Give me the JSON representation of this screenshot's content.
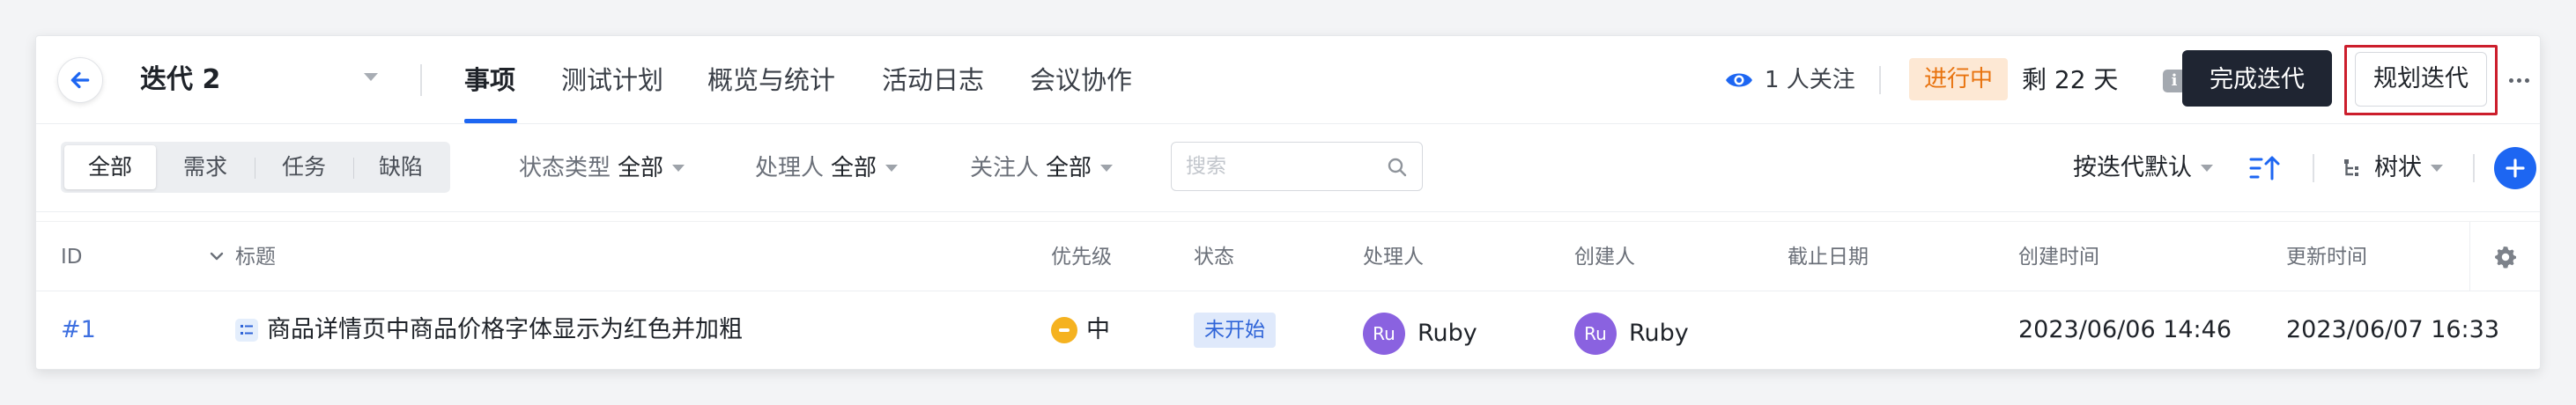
{
  "header": {
    "iteration_title": "迭代 2",
    "tabs": [
      {
        "label": "事项",
        "active": true
      },
      {
        "label": "测试计划",
        "active": false
      },
      {
        "label": "概览与统计",
        "active": false
      },
      {
        "label": "活动日志",
        "active": false
      },
      {
        "label": "会议协作",
        "active": false
      }
    ],
    "watch_text": "1 人关注",
    "status_label": "进行中",
    "remaining": "剩 22 天",
    "info_glyph": "i",
    "complete_button": "完成迭代",
    "plan_button": "规划迭代"
  },
  "toolbar": {
    "segments": [
      "全部",
      "需求",
      "任务",
      "缺陷"
    ],
    "active_segment": "全部",
    "filters": [
      {
        "label": "状态类型",
        "value": "全部"
      },
      {
        "label": "处理人",
        "value": "全部"
      },
      {
        "label": "关注人",
        "value": "全部"
      }
    ],
    "search_placeholder": "搜索",
    "sort_label": "按迭代默认",
    "view_label": "树状"
  },
  "table": {
    "columns": [
      "ID",
      "标题",
      "优先级",
      "状态",
      "处理人",
      "创建人",
      "截止日期",
      "创建时间",
      "更新时间"
    ],
    "rows": [
      {
        "id": "#1",
        "title": "商品详情页中商品价格字体显示为红色并加粗",
        "priority": "中",
        "state": "未开始",
        "assignee_initials": "Ru",
        "assignee": "Ruby",
        "creator_initials": "Ru",
        "creator": "Ruby",
        "due_date": "",
        "created_at": "2023/06/06 14:46",
        "updated_at": "2023/06/07 16:33"
      }
    ]
  },
  "colors": {
    "primary": "#1d66f2",
    "dark_button": "#1f2532",
    "status_badge_bg": "#fde8d4",
    "status_badge_text": "#e8730f",
    "highlight_outline": "#cc1e2c",
    "priority_medium": "#f5b220",
    "avatar": "#8a62e0"
  }
}
